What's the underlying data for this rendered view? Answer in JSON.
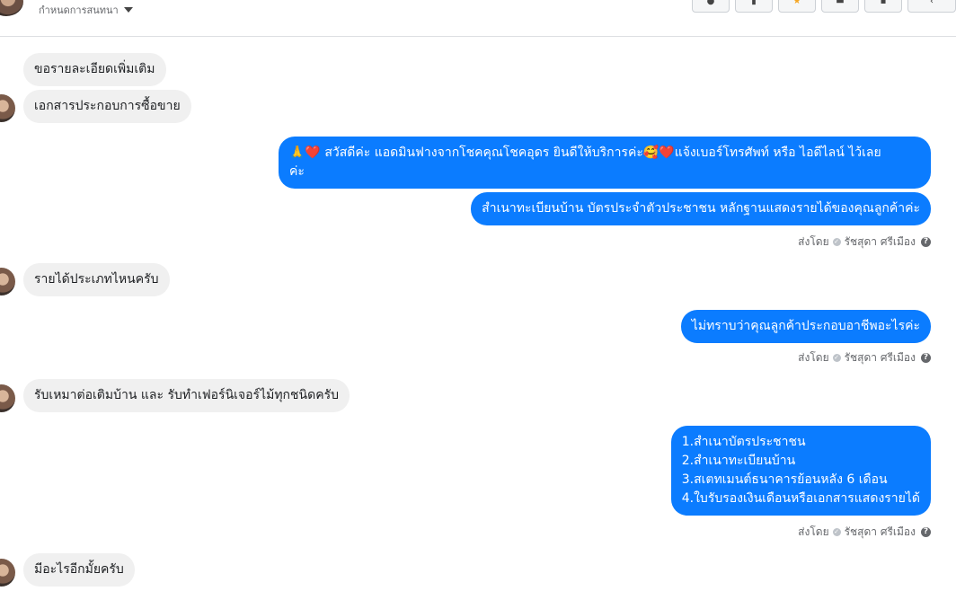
{
  "header": {
    "subtitle": "กำหนดการสนทนา",
    "tools": [
      {
        "icon": "circle-icon",
        "glyph": "●"
      },
      {
        "icon": "trash-icon",
        "glyph": "▮"
      },
      {
        "icon": "star-icon",
        "glyph": "★"
      },
      {
        "icon": "inbox-icon",
        "glyph": "▬"
      },
      {
        "icon": "flag-icon",
        "glyph": "▪"
      },
      {
        "icon": "chevron-icon",
        "glyph": "‹"
      }
    ]
  },
  "messages": {
    "m1": "ขอรายละเอียดเพิ่มเติม",
    "m2": "เอกสารประกอบการซื้อขาย",
    "m3": "🙏❤️ สวัสดีค่ะ แอดมินฟางจากโชคคุณโชคอุดร ยินดีให้บริการค่ะ🥰❤️แจ้งเบอร์โทรศัพท์ หรือ ไอดีไลน์  ไว้เลย",
    "m3b": "ค่ะ",
    "m4": "สำเนาทะเบียนบ้าน บัตรประจำตัวประชาชน หลักฐานแสดงรายได้ของคุณลูกค้าค่ะ",
    "m5": "รายได้ประเภทไหนครับ",
    "m6": "ไม่ทราบว่าคุณลูกค้าประกอบอาชีพอะไรค่ะ",
    "m7": "รับเหมาต่อเติมบ้าน และ รับทำเฟอร์นิเจอร์ไม้ทุกชนิดครับ",
    "m8_lines": [
      "1.สำเนาบัตรประชาชน",
      "2.สำเนาทะเบียนบ้าน",
      "3.สเตทเมนต์ธนาคารย้อนหลัง 6 เดือน",
      "4.ใบรับรองเงินเดือนหรือเอกสารแสดงรายได้"
    ],
    "m9": "มีอะไรอีกมั้ยครับ"
  },
  "sent_by": {
    "prefix": "ส่งโดย",
    "name": "รัชสุดา ศรีเมือง",
    "check": "✓",
    "help": "?"
  }
}
